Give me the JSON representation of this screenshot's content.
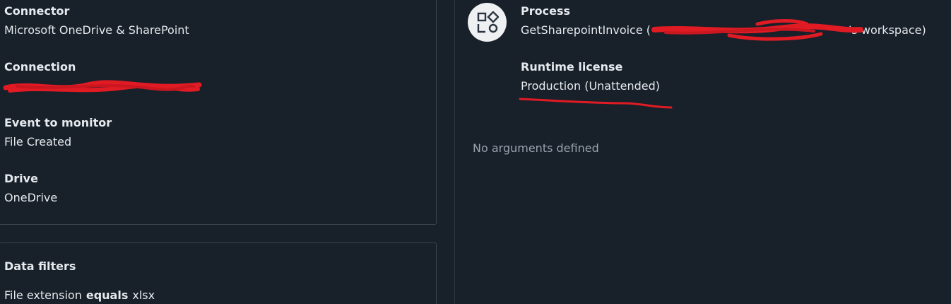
{
  "trigger": {
    "connector_label": "Connector",
    "connector_value": "Microsoft OneDrive & SharePoint",
    "connection_label": "Connection",
    "event_label": "Event to monitor",
    "event_value": "File Created",
    "drive_label": "Drive",
    "drive_value": "OneDrive"
  },
  "filters": {
    "title": "Data filters",
    "rows": [
      {
        "field": "File extension",
        "operator": "equals",
        "value": "xlsx"
      }
    ]
  },
  "process": {
    "icon": "process-icon",
    "process_label": "Process",
    "process_value_prefix": "GetSharepointInvoice (",
    "process_value_suffix": "'s workspace)",
    "license_label": "Runtime license",
    "license_value": "Production (Unattended)"
  },
  "arguments": {
    "empty_text": "No arguments defined"
  },
  "colors": {
    "background": "#18202a",
    "border": "#3a444f",
    "text": "#e6eaee",
    "muted": "#9aa4ae",
    "redaction": "#e01b24"
  }
}
